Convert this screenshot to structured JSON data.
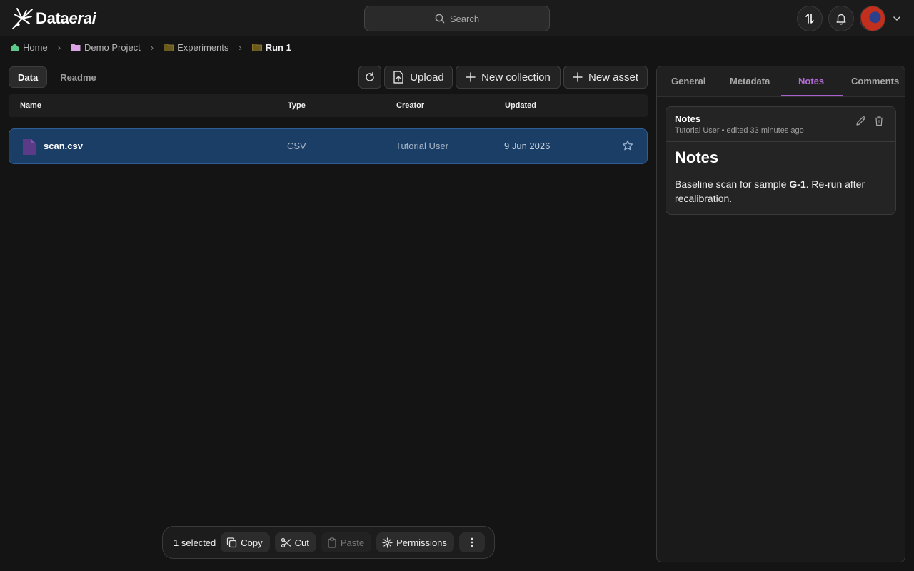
{
  "app": {
    "name_plain": "Data",
    "name_italic": "erai"
  },
  "search": {
    "placeholder": "Search"
  },
  "breadcrumb": [
    {
      "label": "Home",
      "icon": "home-icon"
    },
    {
      "label": "Demo Project",
      "icon": "project-folder-icon"
    },
    {
      "label": "Experiments",
      "icon": "folder-icon"
    },
    {
      "label": "Run 1",
      "icon": "folder-icon"
    }
  ],
  "tabs": [
    {
      "label": "Data",
      "active": true
    },
    {
      "label": "Readme",
      "active": false
    }
  ],
  "toolbar": {
    "upload_label": "Upload",
    "new_collection_label": "New collection",
    "new_asset_label": "New asset"
  },
  "table": {
    "columns": [
      "Name",
      "Type",
      "Creator",
      "Updated"
    ],
    "rows": [
      {
        "name": "scan.csv",
        "type": "CSV",
        "creator": "Tutorial User",
        "updated": "9 Jun 2026",
        "selected": true,
        "starred": false
      }
    ]
  },
  "selection": {
    "count_label": "1 selected",
    "copy_label": "Copy",
    "cut_label": "Cut",
    "paste_label": "Paste",
    "permissions_label": "Permissions"
  },
  "panel": {
    "tabs": [
      "General",
      "Metadata",
      "Notes",
      "Comments"
    ],
    "active_tab": "Notes",
    "note": {
      "title": "Notes",
      "meta": "Tutorial User • edited 33 minutes ago",
      "heading": "Notes",
      "body_before": "Baseline scan for sample ",
      "body_bold": "G-1",
      "body_after": ". Re-run after recalibration."
    }
  },
  "colors": {
    "accent": "#a85fd0",
    "selected_row": "#1b3e66",
    "background": "#141414"
  }
}
